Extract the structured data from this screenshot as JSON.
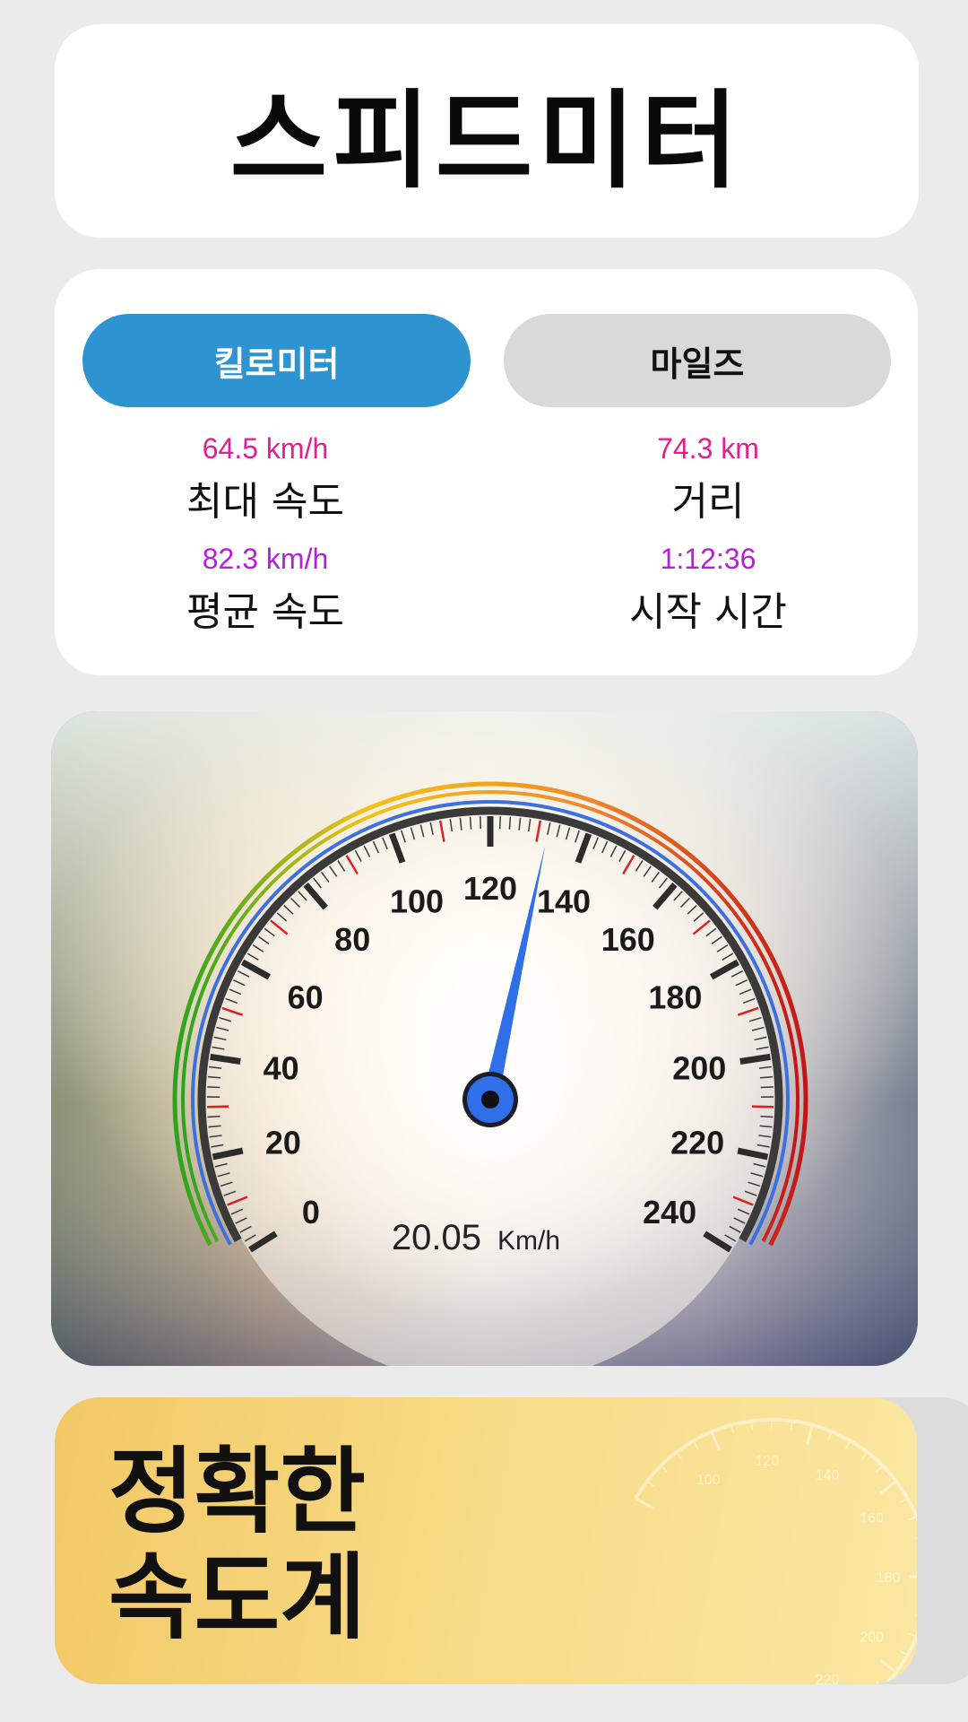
{
  "app": {
    "title": "스피드미터"
  },
  "units": {
    "km_label": "킬로미터",
    "mi_label": "마일즈"
  },
  "stats": {
    "max_speed": {
      "value": "64.5 km/h",
      "label": "최대 속도"
    },
    "distance": {
      "value": "74.3 km",
      "label": "거리"
    },
    "avg_speed": {
      "value": "82.3 km/h",
      "label": "평균 속도"
    },
    "start_time": {
      "value": "1:12:36",
      "label": "시작 시간"
    }
  },
  "gauge": {
    "speed_value": "20.05",
    "speed_unit": "Km/h",
    "needle_reading": 132,
    "min": 0,
    "max": 240,
    "tick_labels": [
      "0",
      "20",
      "40",
      "60",
      "80",
      "100",
      "120",
      "140",
      "160",
      "180",
      "200",
      "220",
      "240"
    ],
    "colors": {
      "needle": "#2f6fe8",
      "accent_red": "#e02020"
    }
  },
  "promo": {
    "line1": "정확한",
    "line2": "속도계",
    "watermark_labels": [
      "100",
      "120",
      "140",
      "160",
      "180",
      "200",
      "220"
    ]
  }
}
